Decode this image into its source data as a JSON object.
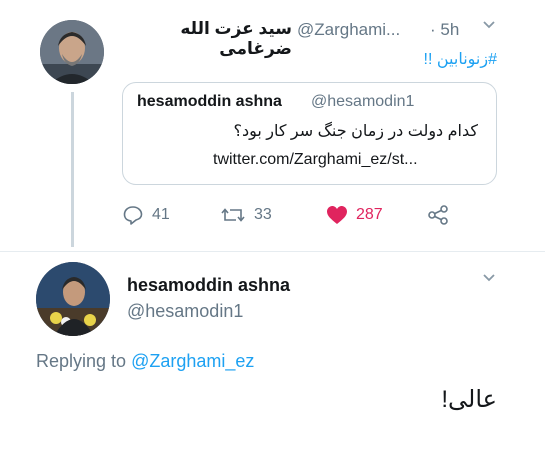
{
  "tweet1": {
    "display_name": "سید عزت الله ضرغامی",
    "handle": "@Zarghami...",
    "time": "· 5h",
    "text": "#زنونابین !!",
    "quote": {
      "name": "hesamoddin ashna",
      "handle": "@hesamodin1",
      "text": "کدام دولت در زمان جنگ سر کار بود؟",
      "link": "twitter.com/Zarghami_ez/st..."
    },
    "actions": {
      "replies": "41",
      "retweets": "33",
      "likes": "287"
    },
    "colors": {
      "like": "#e0245e",
      "link": "#1da1f2",
      "icon": "#657786"
    }
  },
  "tweet2": {
    "name": "hesamoddin ashna",
    "handle": "@hesamodin1",
    "replying_label": "Replying to",
    "replying_handle": "@Zarghami_ez",
    "text": "عالی!"
  }
}
